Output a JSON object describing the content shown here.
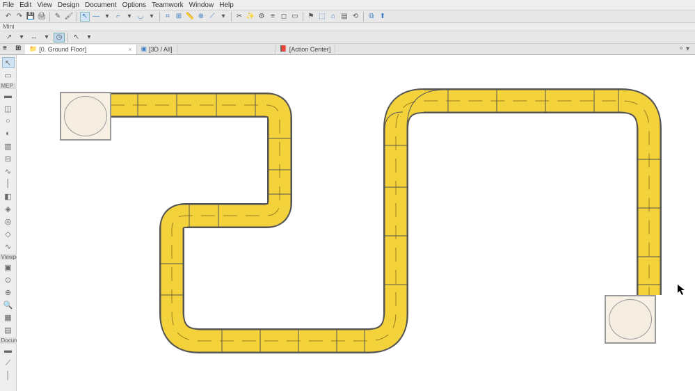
{
  "menu": {
    "file": "File",
    "edit": "Edit",
    "view": "View",
    "design": "Design",
    "document": "Document",
    "options": "Options",
    "teamwork": "Teamwork",
    "window": "Window",
    "help": "Help"
  },
  "panels": {
    "mini": "Mini"
  },
  "tabs": {
    "ground_floor": "[0. Ground Floor]",
    "three_d": "[3D / All]",
    "action_center": "[Action Center]",
    "close": "×"
  },
  "sidebar": {
    "sections": {
      "mep": "MEP",
      "viewpoint": "Viewpoint",
      "document": "Documen"
    }
  },
  "icons": {
    "undo": "↶",
    "redo": "↷",
    "save": "💾",
    "print": "🖨",
    "eyedrop": "✎",
    "brush": "🖌",
    "cursor": "↖",
    "line": "—",
    "polyline": "⌐",
    "rect": "▭",
    "arc": "◡",
    "grid": "⌗",
    "snap": "⊞",
    "ruler": "📏",
    "compass": "⊕",
    "measure": "⟋",
    "scissors": "✂",
    "wand": "✨",
    "adjust": "⚙",
    "layers": "≡",
    "trace": "◻",
    "flag": "⚑",
    "box3d": "⬚",
    "house": "⌂",
    "sheet": "▤",
    "rotate": "⟲",
    "link": "⧉",
    "export": "⬆",
    "arrow": "↖",
    "rectangle": "▭",
    "wall": "▬",
    "duct": "◫",
    "pipe": "○",
    "fitting": "◐",
    "equipment": "▥",
    "tray": "⊟",
    "flex": "∿",
    "conduit": "│",
    "panel": "◧",
    "junction": "◈",
    "terminal": "◎",
    "accessory": "◇",
    "camera": "▣",
    "orbit": "⊙",
    "target": "⊕",
    "zoom": "🔍",
    "section": "▦",
    "sheet2": "▤",
    "wall2": "▬",
    "stair": "⟋",
    "column": "│",
    "list": "≡",
    "folder": "📁",
    "book": "📕",
    "palette": "⊞",
    "dropdown": "▾",
    "polyarrow": "↗",
    "clock": "◷",
    "splitarrow": "↔"
  }
}
